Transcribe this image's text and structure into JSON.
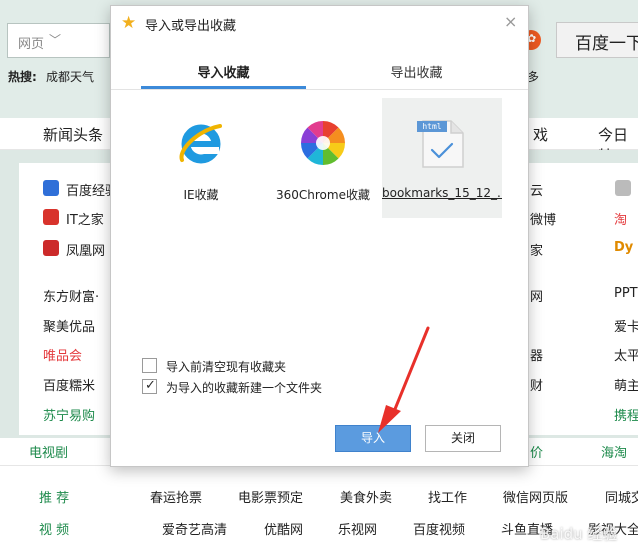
{
  "background": {
    "search": {
      "select_label": "网页",
      "baidu_button": "百度一下"
    },
    "hot": {
      "label": "热搜:",
      "item": "成都天气",
      "right_fragment": "多"
    },
    "nav": [
      "新闻头条",
      "戏",
      "今日特"
    ],
    "sites_left": [
      {
        "label": "百度经验",
        "icon_color": "#2f6fd8"
      },
      {
        "label": "IT之家",
        "icon_color": "#d8332c"
      },
      {
        "label": "凤凰网",
        "icon_color": "#cc2a2a"
      }
    ],
    "sites_left_text": [
      "东方财富·",
      "聚美优品",
      "唯品会",
      "百度糯米",
      "苏宁易购"
    ],
    "sites_mid_right": [
      "云",
      "微博",
      "家",
      "网",
      "器",
      "财"
    ],
    "sites_far_right": [
      "淘",
      "Dy",
      "PPT",
      "爱卡",
      "太平",
      "萌主",
      "携程"
    ],
    "bottom_tabs": [
      "电视剧",
      "价",
      "海淘"
    ],
    "bottom_row1": {
      "category": "推 荐",
      "links": [
        "春运抢票",
        "电影票预定",
        "美食外卖",
        "找工作",
        "微信网页版",
        "同城交"
      ]
    },
    "bottom_row2": {
      "category": "视 频",
      "links": [
        "爱奇艺高清",
        "优酷网",
        "乐视网",
        "百度视频",
        "斗鱼直播",
        "影视大全"
      ]
    },
    "watermark": "Baidu 经验"
  },
  "dialog": {
    "title": "导入或导出收藏",
    "close_glyph": "×",
    "tabs": {
      "import": "导入收藏",
      "export": "导出收藏"
    },
    "sources": [
      {
        "label": "IE收藏",
        "icon": "ie-icon"
      },
      {
        "label": "360Chrome收藏",
        "icon": "360chrome-icon"
      },
      {
        "label": "bookmarks_15_12_...",
        "icon": "html-file-icon",
        "icon_badge": "html",
        "selected": true
      }
    ],
    "options": [
      {
        "label": "导入前清空现有收藏夹",
        "checked": false
      },
      {
        "label": "为导入的收藏新建一个文件夹",
        "checked": true
      }
    ],
    "buttons": {
      "import": "导入",
      "close": "关闭"
    }
  },
  "colors": {
    "accent": "#3c8ad9",
    "primary_button": "#5b9bdf",
    "annotation_arrow": "#e8302a"
  }
}
